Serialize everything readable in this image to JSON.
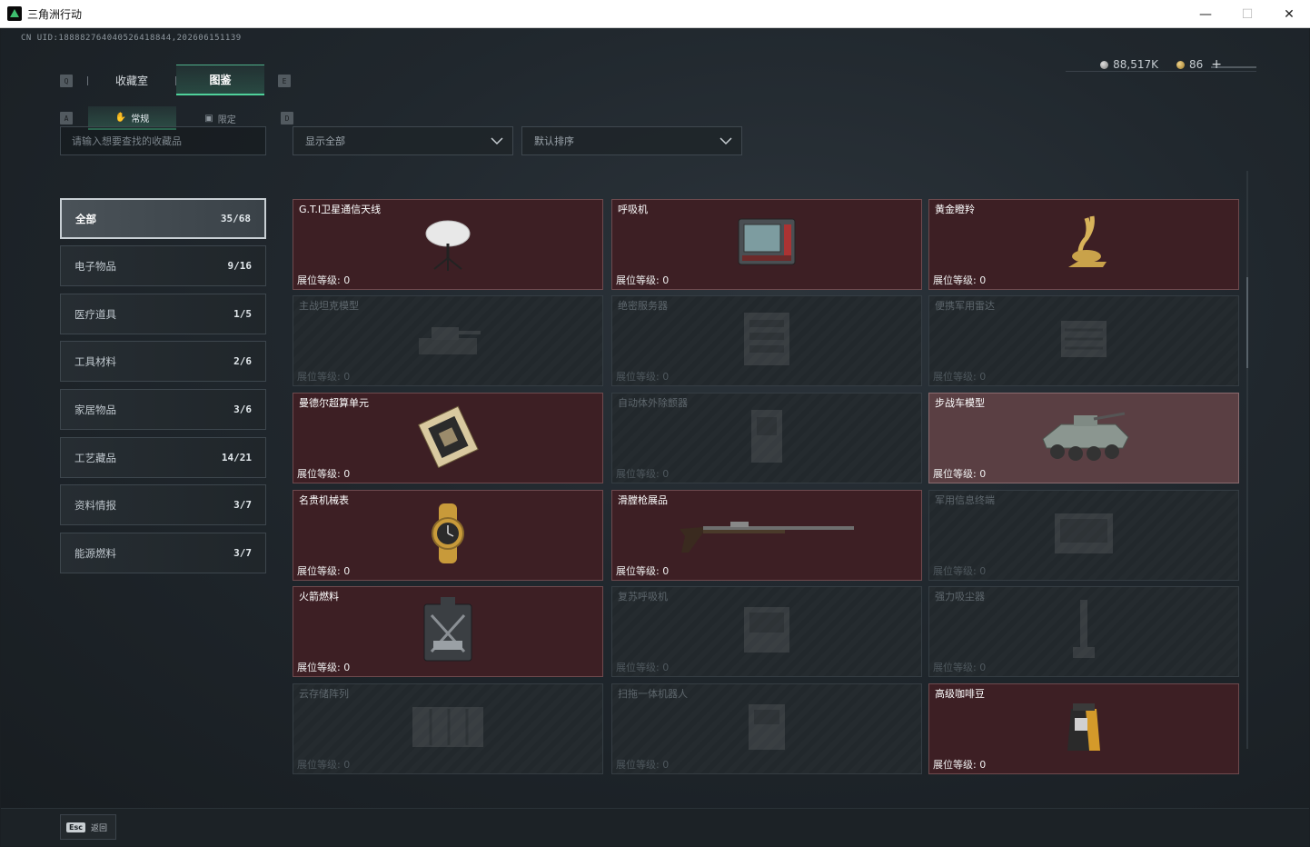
{
  "window": {
    "title": "三角洲行动",
    "minimize": "—",
    "maximize": "☐",
    "close": "✕"
  },
  "uid": "CN UID:18888276404052641884​4,202606151139",
  "currency": {
    "silver": "88,517K",
    "gold": "86",
    "add": "+"
  },
  "keys": {
    "q": "Q",
    "e": "E",
    "a": "A",
    "d": "D"
  },
  "tabs": {
    "collection": "收藏室",
    "catalog": "图鉴"
  },
  "subtabs": {
    "normal": "常规",
    "limited": "限定"
  },
  "search": {
    "placeholder": "请输入想要查找的收藏品"
  },
  "filters": {
    "show": "显示全部",
    "sort": "默认排序"
  },
  "categories": [
    {
      "label": "全部",
      "count": "35/68"
    },
    {
      "label": "电子物品",
      "count": "9/16"
    },
    {
      "label": "医疗道具",
      "count": "1/5"
    },
    {
      "label": "工具材料",
      "count": "2/6"
    },
    {
      "label": "家居物品",
      "count": "3/6"
    },
    {
      "label": "工艺藏品",
      "count": "14/21"
    },
    {
      "label": "资料情报",
      "count": "3/7"
    },
    {
      "label": "能源燃料",
      "count": "3/7"
    }
  ],
  "items": [
    {
      "name": "G.T.I卫星通信天线",
      "level": "展位等级: 0",
      "owned": true,
      "icon": "satellite-dish-icon"
    },
    {
      "name": "呼吸机",
      "level": "展位等级: 0",
      "owned": true,
      "icon": "ventilator-icon"
    },
    {
      "name": "黄金瞪羚",
      "level": "展位等级: 0",
      "owned": true,
      "icon": "golden-gazelle-icon"
    },
    {
      "name": "主战坦克模型",
      "level": "展位等级: 0",
      "owned": false,
      "icon": "tank-model-icon"
    },
    {
      "name": "绝密服务器",
      "level": "展位等级: 0",
      "owned": false,
      "icon": "server-icon"
    },
    {
      "name": "便携军用雷达",
      "level": "展位等级: 0",
      "owned": false,
      "icon": "radar-icon"
    },
    {
      "name": "曼德尔超算单元",
      "level": "展位等级: 0",
      "owned": true,
      "icon": "supercomputer-chip-icon"
    },
    {
      "name": "自动体外除颤器",
      "level": "展位等级: 0",
      "owned": false,
      "icon": "defibrillator-icon"
    },
    {
      "name": "步战车模型",
      "level": "展位等级: 0",
      "owned": true,
      "light": true,
      "icon": "ifv-model-icon"
    },
    {
      "name": "名贵机械表",
      "level": "展位等级: 0",
      "owned": true,
      "icon": "watch-icon"
    },
    {
      "name": "滑膛枪展品",
      "level": "展位等级: 0",
      "owned": true,
      "icon": "musket-icon"
    },
    {
      "name": "军用信息终端",
      "level": "展位等级: 0",
      "owned": false,
      "icon": "terminal-icon"
    },
    {
      "name": "火箭燃料",
      "level": "展位等级: 0",
      "owned": true,
      "icon": "fuel-can-icon"
    },
    {
      "name": "复苏呼吸机",
      "level": "展位等级: 0",
      "owned": false,
      "icon": "resuscitator-icon"
    },
    {
      "name": "强力吸尘器",
      "level": "展位等级: 0",
      "owned": false,
      "icon": "vacuum-icon"
    },
    {
      "name": "云存储阵列",
      "level": "展位等级: 0",
      "owned": false,
      "icon": "storage-array-icon"
    },
    {
      "name": "扫拖一体机器人",
      "level": "展位等级: 0",
      "owned": false,
      "icon": "robot-vacuum-icon"
    },
    {
      "name": "高级咖啡豆",
      "level": "展位等级: 0",
      "owned": true,
      "icon": "coffee-bag-icon"
    }
  ],
  "footer": {
    "esc_key": "Esc",
    "back_label": "返回"
  }
}
